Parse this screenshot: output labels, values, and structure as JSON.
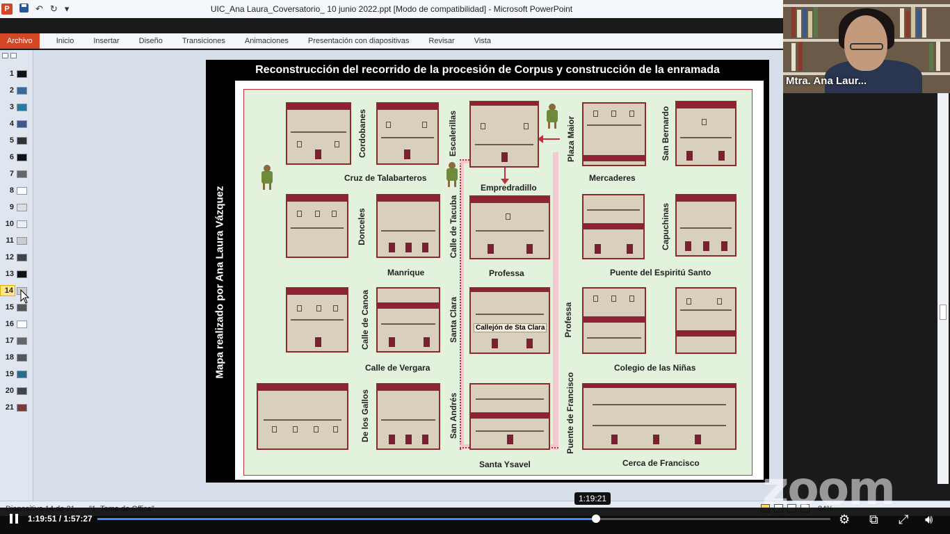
{
  "window": {
    "title": "UIC_Ana Laura_Coversatorio_ 10 junio 2022.ppt [Modo de compatibilidad]  -  Microsoft PowerPoint",
    "app_icon_letter": "P"
  },
  "ribbon_tabs": {
    "archivo": "Archivo",
    "tabs": [
      "Inicio",
      "Insertar",
      "Diseño",
      "Transiciones",
      "Animaciones",
      "Presentación con diapositivas",
      "Revisar",
      "Vista"
    ]
  },
  "thumbnails": {
    "numbers": [
      "1",
      "2",
      "3",
      "4",
      "5",
      "6",
      "7",
      "8",
      "9",
      "10",
      "11",
      "12",
      "13",
      "14",
      "15",
      "16",
      "17",
      "18",
      "19",
      "20",
      "21"
    ],
    "active": "14"
  },
  "slide": {
    "title": "Reconstrucción del recorrido de la procesión de Corpus y construcción de la enramada",
    "credit": "Mapa realizado por Ana Laura Vázquez",
    "labels": {
      "cordobanes": "Cordobanes",
      "escalerillas": "Escalerillas",
      "plaza_maior": "Plaza Maior",
      "san_bernardo": "San Bernardo",
      "cruz_talabarteros": "Cruz de Talabarteros",
      "empredradillo": "Empredradillo",
      "mercaderes": "Mercaderes",
      "donceles": "Donceles",
      "calle_tacuba": "Calle de Tacuba",
      "capuchinas": "Capuchinas",
      "manrique": "Manrique",
      "professa_h": "Professa",
      "puente_espiritu": "Puente del Espiritú Santo",
      "calle_canoa": "Calle de Canoa",
      "santa_clara": "Santa Clara",
      "callejon": "Callejón de Sta Clara",
      "professa_v": "Professa",
      "calle_vergara": "Calle de Vergara",
      "colegio_ninas": "Colegio de las Niñas",
      "de_los_gallos": "De los Gallos",
      "san_andres": "San Andrés",
      "puente_francisco": "Puente de Francisco",
      "santa_ysavel": "Santa Ysavel",
      "cerca_francisco": "Cerca de Francisco"
    }
  },
  "statusbar": {
    "slide_info": "Diapositiva 14 de 21",
    "theme": "\"1_Tema de Office\"",
    "zoom": "84%"
  },
  "webcam": {
    "name": "Mtra. Ana Laur..."
  },
  "watermark": "zoom",
  "player": {
    "time": "1:19:51 / 1:57:27",
    "hover_time": "1:19:21",
    "progress": 0.68,
    "accent": "#3d8bff"
  }
}
